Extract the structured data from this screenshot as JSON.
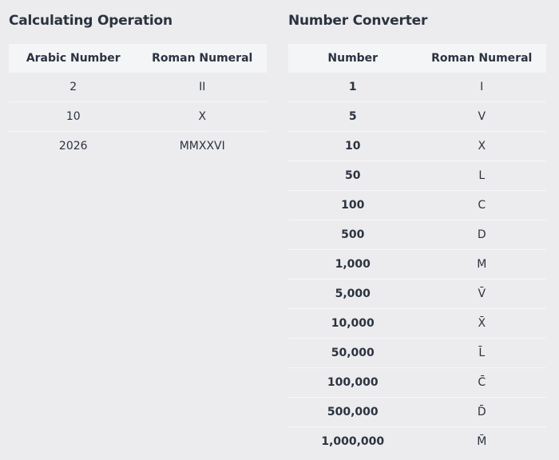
{
  "calculating_operation": {
    "title": "Calculating Operation",
    "headers": [
      "Arabic Number",
      "Roman Numeral"
    ],
    "rows": [
      [
        "2",
        "II"
      ],
      [
        "10",
        "X"
      ],
      [
        "2026",
        "MMXXVI"
      ]
    ]
  },
  "number_converter": {
    "title": "Number Converter",
    "headers": [
      "Number",
      "Roman Numeral"
    ],
    "rows": [
      [
        "1",
        "I"
      ],
      [
        "5",
        "V"
      ],
      [
        "10",
        "X"
      ],
      [
        "50",
        "L"
      ],
      [
        "100",
        "C"
      ],
      [
        "500",
        "D"
      ],
      [
        "1,000",
        "M"
      ],
      [
        "5,000",
        "V̄"
      ],
      [
        "10,000",
        "X̄"
      ],
      [
        "50,000",
        "L̄"
      ],
      [
        "100,000",
        "C̄"
      ],
      [
        "500,000",
        "D̄"
      ],
      [
        "1,000,000",
        "M̄"
      ]
    ]
  }
}
